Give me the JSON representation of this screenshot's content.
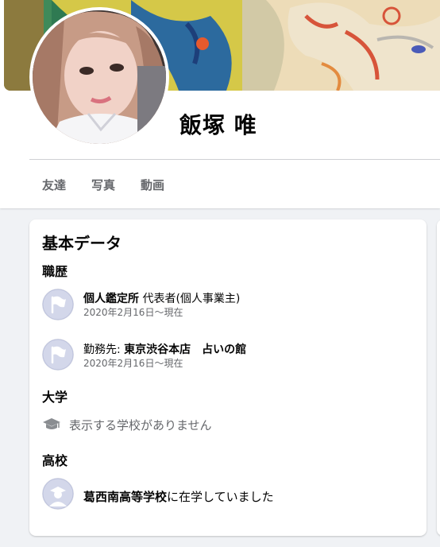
{
  "profile": {
    "name": "飯塚 唯",
    "tabs": [
      {
        "label": "友達"
      },
      {
        "label": "写真"
      },
      {
        "label": "動画"
      }
    ]
  },
  "about": {
    "title": "基本データ",
    "work": {
      "heading": "職歴",
      "items": [
        {
          "prefix": "",
          "employer": "個人鑑定所",
          "detail": " 代表者(個人事業主)",
          "dates": "2020年2月16日～現在",
          "icon": "flag-icon"
        },
        {
          "prefix": "勤務先: ",
          "employer": "東京渋谷本店　占いの館",
          "detail": "",
          "dates": "2020年2月16日～現在",
          "icon": "flag-icon"
        }
      ]
    },
    "college": {
      "heading": "大学",
      "empty_text": "表示する学校がありません",
      "icon": "graduation-cap-icon"
    },
    "high_school": {
      "heading": "高校",
      "school": "葛西南高等学校",
      "suffix": "に在学していました",
      "icon": "school-avatar-icon"
    }
  },
  "colors": {
    "background": "#f0f2f5",
    "card": "#ffffff",
    "secondary_text": "#65676b",
    "icon_tint": "#c9cde6"
  }
}
